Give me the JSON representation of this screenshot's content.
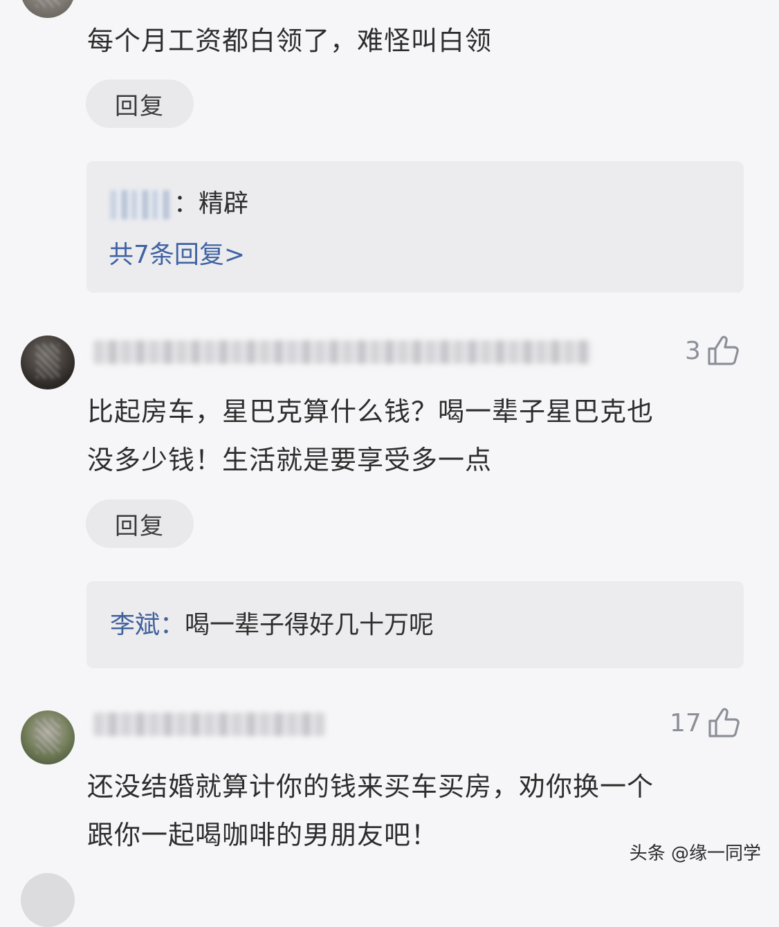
{
  "comments": [
    {
      "text_lines": [
        "每个月工资都白领了，难怪叫白领"
      ],
      "reply_label": "回复",
      "replies": [
        {
          "author": "",
          "text": "：精辟"
        }
      ],
      "more_replies": "共7条回复>"
    },
    {
      "likes": "3",
      "text_lines": [
        "比起房车，星巴克算什么钱？喝一辈子星巴克也",
        "没多少钱！生活就是要享受多一点"
      ],
      "reply_label": "回复",
      "replies": [
        {
          "author": "李斌：",
          "text": "喝一辈子得好几十万呢"
        }
      ]
    },
    {
      "likes": "17",
      "text_lines": [
        "还没结婚就算计你的钱来买车买房，劝你换一个",
        "跟你一起喝咖啡的男朋友吧！"
      ]
    }
  ],
  "watermark": "头条 @缘一同学",
  "icons": {
    "like": "thumbs-up-icon",
    "avatar": "avatar"
  },
  "colors": {
    "background": "#f6f6f8",
    "reply_author": "#40619b",
    "link": "#3f63a3",
    "reply_box": "#ececef",
    "reply_button": "#e9e9ec"
  }
}
